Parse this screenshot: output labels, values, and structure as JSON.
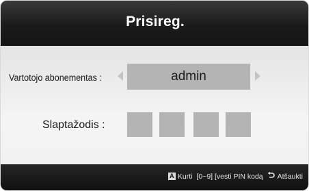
{
  "dialog": {
    "title": "Prisireg.",
    "username_label": "Vartotojo abonementas :",
    "username_value": "admin",
    "password_label": "Slaptažodis :",
    "pin_slots": 4
  },
  "footer": {
    "key_a": "A",
    "create_label": "Kurti",
    "enter_pin_hint": "[0~9] [vesti PIN kodą",
    "return_label": "Atšaukti"
  },
  "colors": {
    "header": "#1b1b1b",
    "field": "#b4b4b4",
    "body": "#f1f1f1",
    "arrow": "#c4c4c4"
  },
  "icons": [
    "arrow-left-icon",
    "arrow-right-icon",
    "a-key-icon",
    "return-icon"
  ]
}
